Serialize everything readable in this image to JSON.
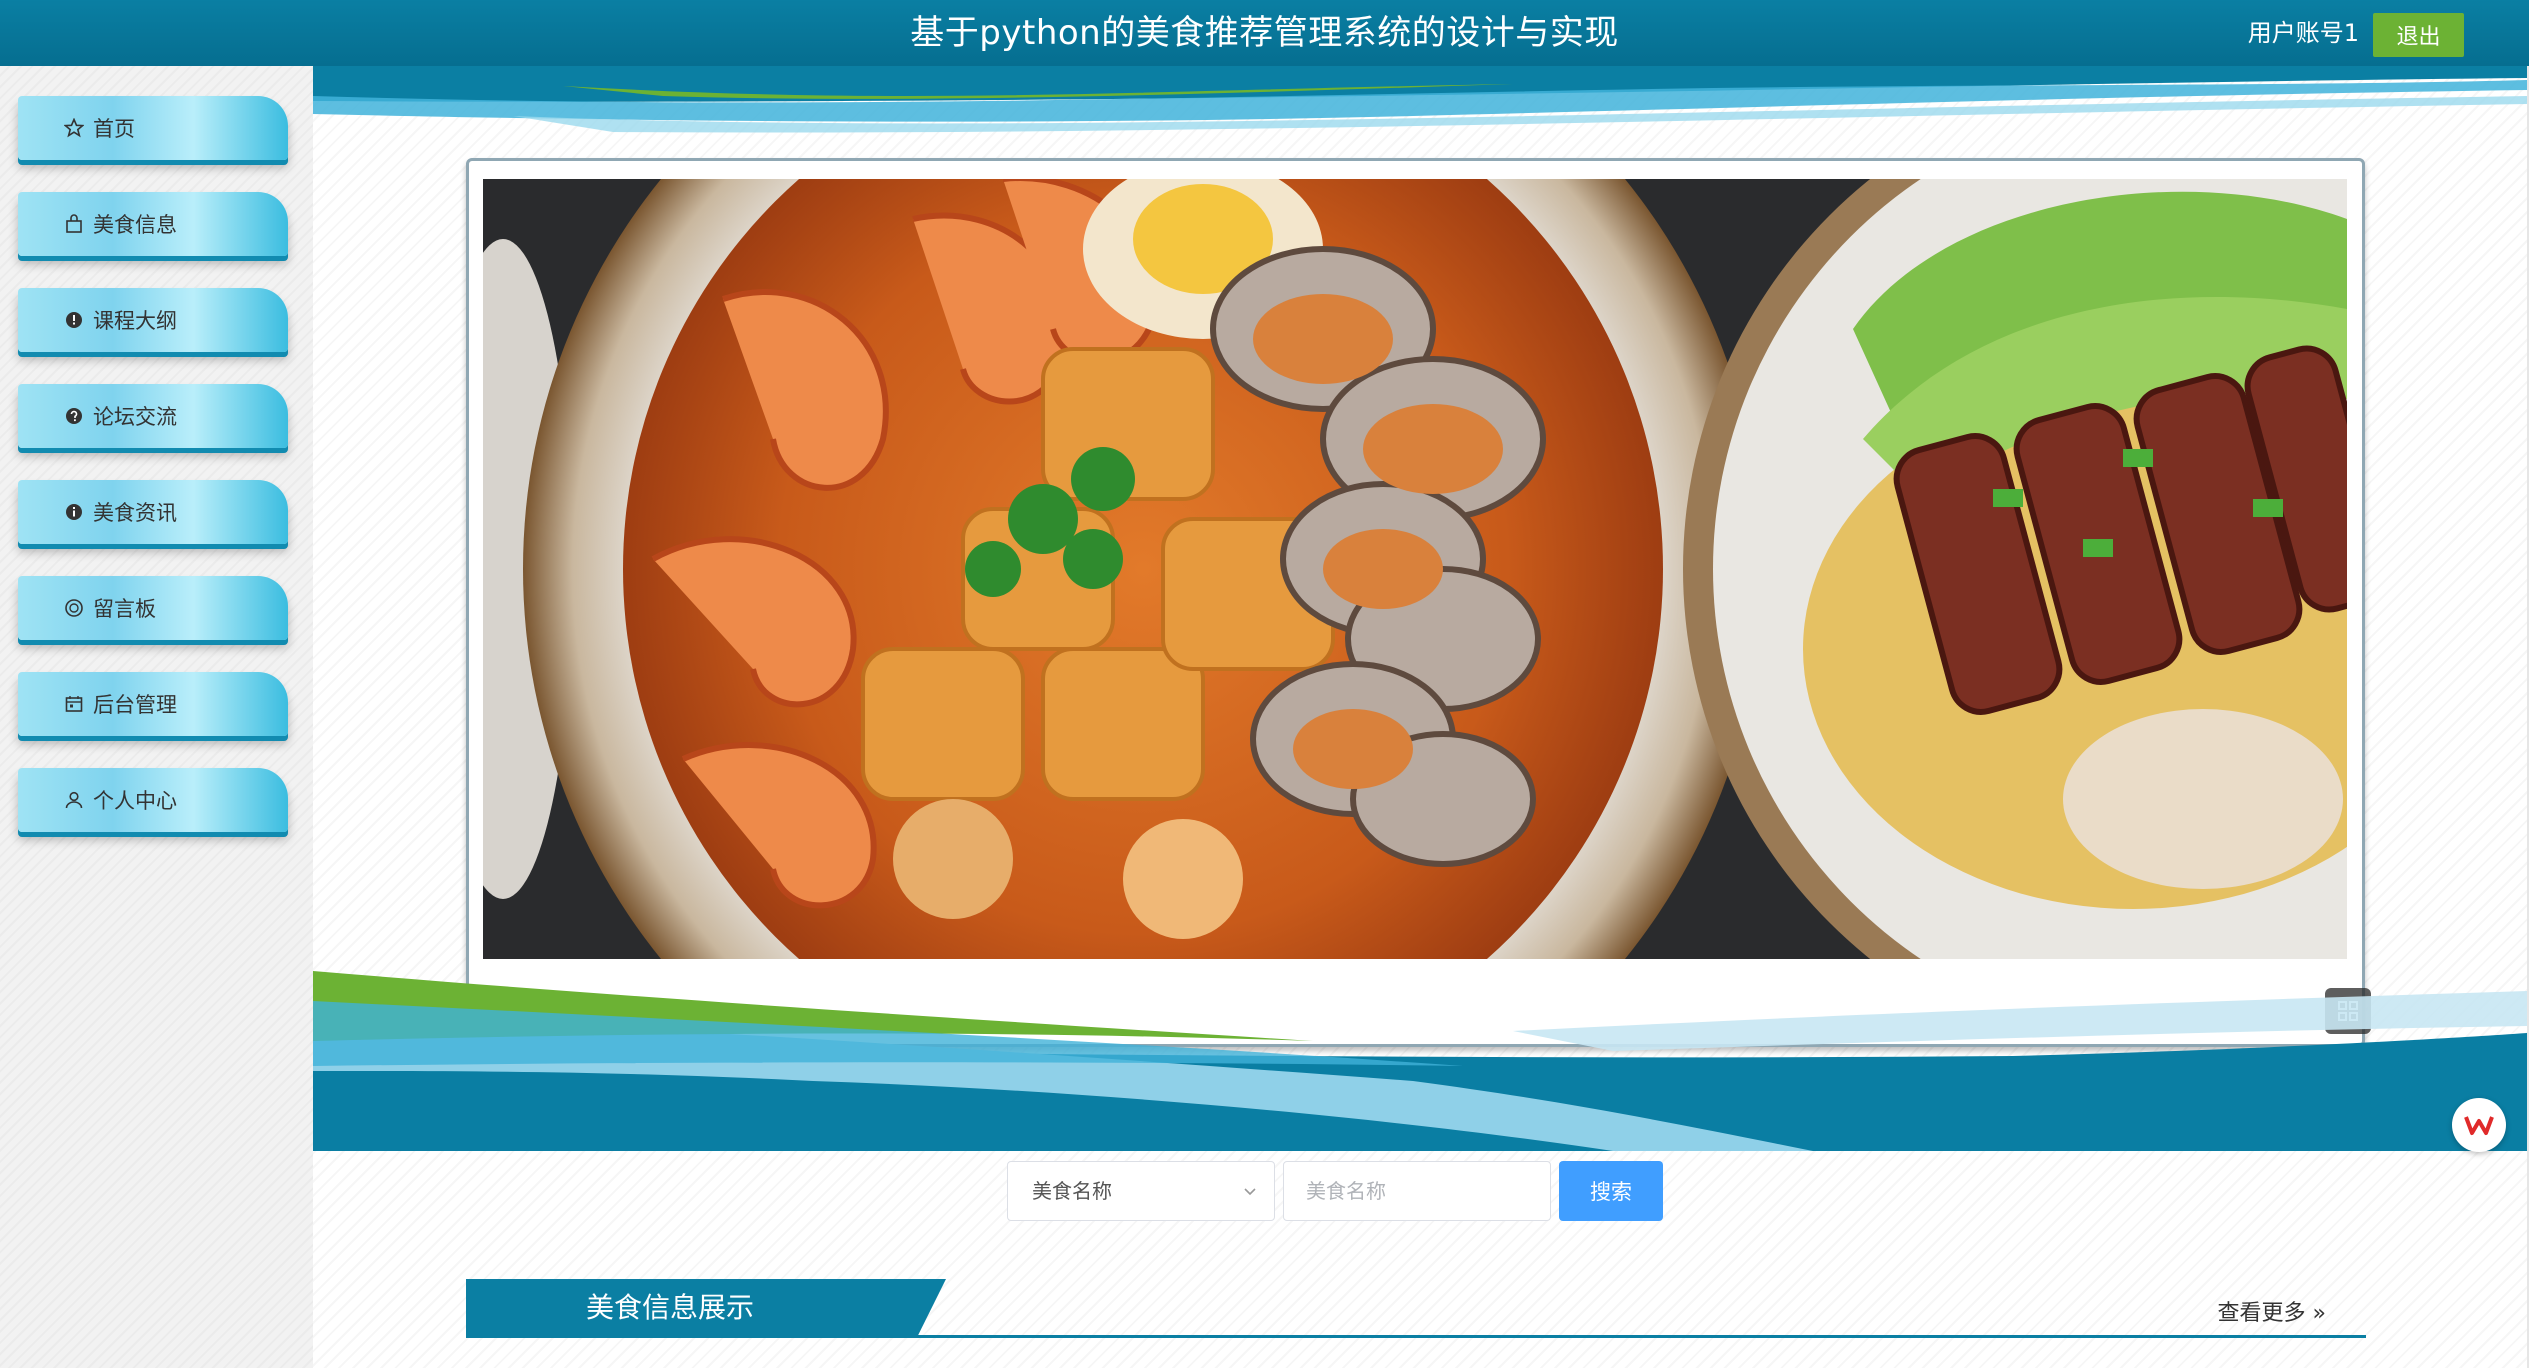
{
  "header": {
    "title": "基于python的美食推荐管理系统的设计与实现",
    "user_label": "用户账号1",
    "logout_label": "退出"
  },
  "sidebar": {
    "items": [
      {
        "label": "首页",
        "icon": "star-icon"
      },
      {
        "label": "美食信息",
        "icon": "bag-icon"
      },
      {
        "label": "课程大纲",
        "icon": "info-circle-icon"
      },
      {
        "label": "论坛交流",
        "icon": "question-circle-icon"
      },
      {
        "label": "美食资讯",
        "icon": "info-circle-icon"
      },
      {
        "label": "留言板",
        "icon": "message-icon"
      },
      {
        "label": "后台管理",
        "icon": "calendar-icon"
      },
      {
        "label": "个人中心",
        "icon": "user-icon"
      }
    ]
  },
  "carousel": {
    "slide_count": 3,
    "active_index": 0,
    "image": "seafood noodle bowl with shrimp, tofu and clams beside roast pork wonton noodles"
  },
  "search": {
    "select_value": "美食名称",
    "input_placeholder": "美食名称",
    "button_label": "搜索"
  },
  "section": {
    "title": "美食信息展示",
    "more_label": "查看更多"
  },
  "colors": {
    "header_bg": "#0a7fa3",
    "logout_bg": "#6cb234",
    "search_btn": "#409eff",
    "accent": "#0b7fa3"
  }
}
